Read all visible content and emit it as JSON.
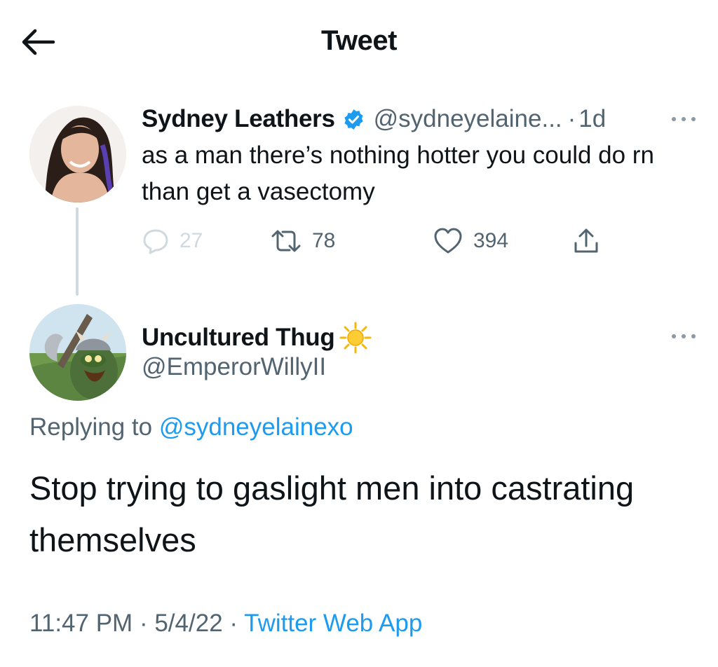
{
  "header": {
    "title": "Tweet"
  },
  "parent_tweet": {
    "display_name": "Sydney Leathers",
    "handle": "@sydneyelaine...",
    "time_ago": "1d",
    "text": "as a man there’s nothing hotter you could do rn than get a vasectomy",
    "replies": "27",
    "retweets": "78",
    "likes": "394"
  },
  "main_tweet": {
    "display_name": "Uncultured Thug",
    "handle": "@EmperorWillyII",
    "replying_prefix": "Replying to",
    "replying_handle": "@sydneyelainexo",
    "text": "Stop trying to gaslight men into castrating themselves",
    "time": "11:47 PM",
    "date": "5/4/22",
    "source": "Twitter Web App"
  },
  "separator": "·",
  "colors": {
    "accent": "#1d9bf0",
    "secondary_text": "#536471",
    "thread_line": "#cfd9de"
  },
  "icons": [
    "back-arrow-icon",
    "verified-badge-icon",
    "more-options-icon",
    "reply-icon",
    "retweet-icon",
    "like-icon",
    "share-icon",
    "sun-emoji-icon"
  ]
}
